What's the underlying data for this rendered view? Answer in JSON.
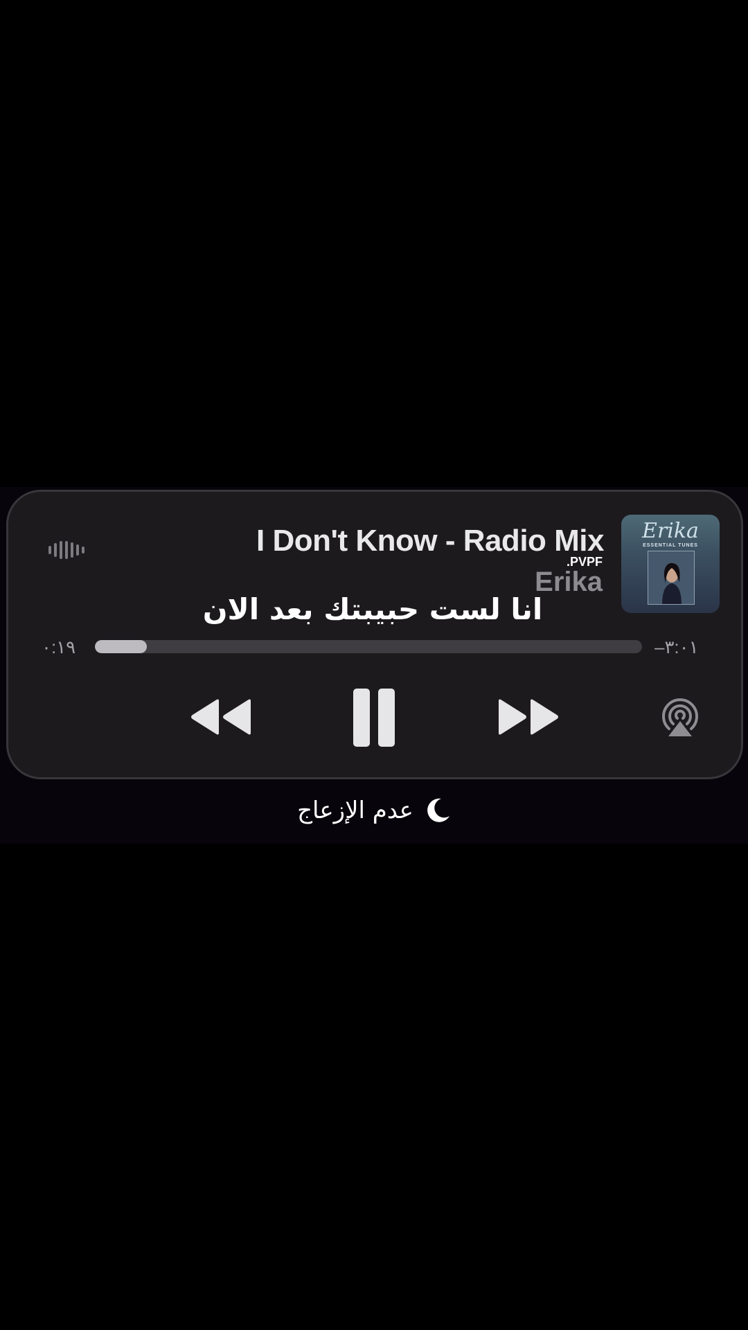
{
  "player": {
    "track_title": "I Don't Know - Radio Mix",
    "artist": "Erika",
    "watermark": ".PVPF",
    "elapsed_time": "٠:١٩",
    "remaining_time": "–٣:٠١",
    "progress_fraction": 0.095,
    "artwork": {
      "name": "Erika",
      "subtitle": "ESSENTIAL TUNES"
    },
    "controls": {
      "rewind_icon": "rewind-icon",
      "pause_icon": "pause-icon",
      "forward_icon": "fast-forward-icon",
      "airplay_icon": "airplay-icon",
      "waveform_icon": "waveform-icon"
    }
  },
  "subtitle_text": "انا لست حبيبتك بعد الان",
  "focus_status": {
    "label": "عدم الإزعاج",
    "icon": "moon-icon"
  },
  "colors": {
    "panel": "#1c1a1d",
    "progress_fill": "#bdbbc0",
    "progress_track": "#3f3d41",
    "artist_gray": "#8e8b90"
  }
}
